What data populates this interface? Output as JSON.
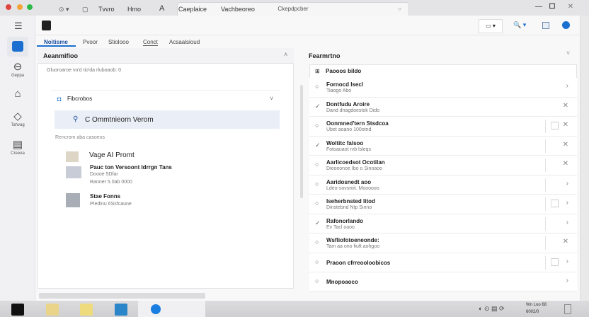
{
  "window": {
    "title": "Ckepdpcber",
    "min": "—",
    "max": "☐",
    "close": "✕"
  },
  "toolbar": {
    "items": [
      "Tvvro",
      "Hmo",
      "Caeplaice",
      "Vachbeoreo"
    ],
    "font_icon": "A",
    "view_btn": "▭ ▾",
    "search": "🔍 ▾"
  },
  "rail": [
    {
      "label": "",
      "icon": "app-icon"
    },
    {
      "label": "Geppa",
      "icon": "cup-icon"
    },
    {
      "label": "",
      "icon": "home-icon"
    },
    {
      "label": "Tahvag",
      "icon": "tag-icon"
    },
    {
      "label": "Creeoa",
      "icon": "panel-icon"
    }
  ],
  "tabs": [
    "Noitisme",
    "Pvoor",
    "Stiolooo",
    "Conct",
    "Acsaalsioud"
  ],
  "left": {
    "title": "Aeanmifioo",
    "subtitle": "Gluoroaroe vo'd tio'da rluboaob: 0",
    "section": "Fibcrobos",
    "search": "C Ommtnieorn Verom",
    "results_label": "Rencrom aba casoeos",
    "items": [
      {
        "title": "Vage AI Promt",
        "lines": []
      },
      {
        "title": "Pauc ton Versoont Idrrgn Tans",
        "lines": [
          "Doooe 5Dfar",
          "Ranner 5.0ab 0000"
        ]
      },
      {
        "title": "Stae Fonns",
        "lines": [
          "Ptedinu 6Ssfcaune"
        ]
      }
    ]
  },
  "right": {
    "title": "Fearmrtno",
    "header": "Paooos bildo",
    "rows": [
      {
        "check": "○",
        "title": "Fornocd lsecl",
        "sub": "Tiaogo Abo",
        "box": false,
        "x": "›"
      },
      {
        "check": "✓",
        "title": "Dontfudu Aroire",
        "sub": "Dand dnagdoestok Dido",
        "box": false,
        "x": "✕"
      },
      {
        "check": "○",
        "title": "Oonmned'tern Stsdcoa",
        "sub": "Ubet aoano 100otnd",
        "box": true,
        "x": "✕"
      },
      {
        "check": "✓",
        "title": "Woltitc falsoo",
        "sub": "Fotoauaot rvb lsleqs",
        "box": false,
        "x": "✕"
      },
      {
        "check": "○",
        "title": "Aarlicoedsot Ocotilan",
        "sub": "Dieoeonoe Ibo o Sinoaoo",
        "box": false,
        "x": "✕"
      },
      {
        "check": "○",
        "title": "Aaridosnedt aoo",
        "sub": "Ldeo-sovsmit. Moooooo",
        "box": false,
        "x": "›"
      },
      {
        "check": "○",
        "title": "Iseherbnsted litod",
        "sub": "Dinstebnd Ntp Sinno",
        "box": true,
        "x": "›"
      },
      {
        "check": "✓",
        "title": "Rafonorlando",
        "sub": "Ev Tacl oaoo",
        "box": false,
        "x": "›"
      },
      {
        "check": "○",
        "title": "Wsfliofotoeneonde:",
        "sub": "Tam aa ono fiuft aohgoo",
        "box": false,
        "x": "✕"
      },
      {
        "check": "○",
        "title": "Praoon cfrreooloobicos",
        "sub": "",
        "box": true,
        "x": "›"
      },
      {
        "check": "○",
        "title": "Mnopoaoco",
        "sub": "",
        "box": false,
        "x": "›"
      }
    ]
  },
  "tray": {
    "time": "Wn Loo 68",
    "date": "6002/0"
  }
}
